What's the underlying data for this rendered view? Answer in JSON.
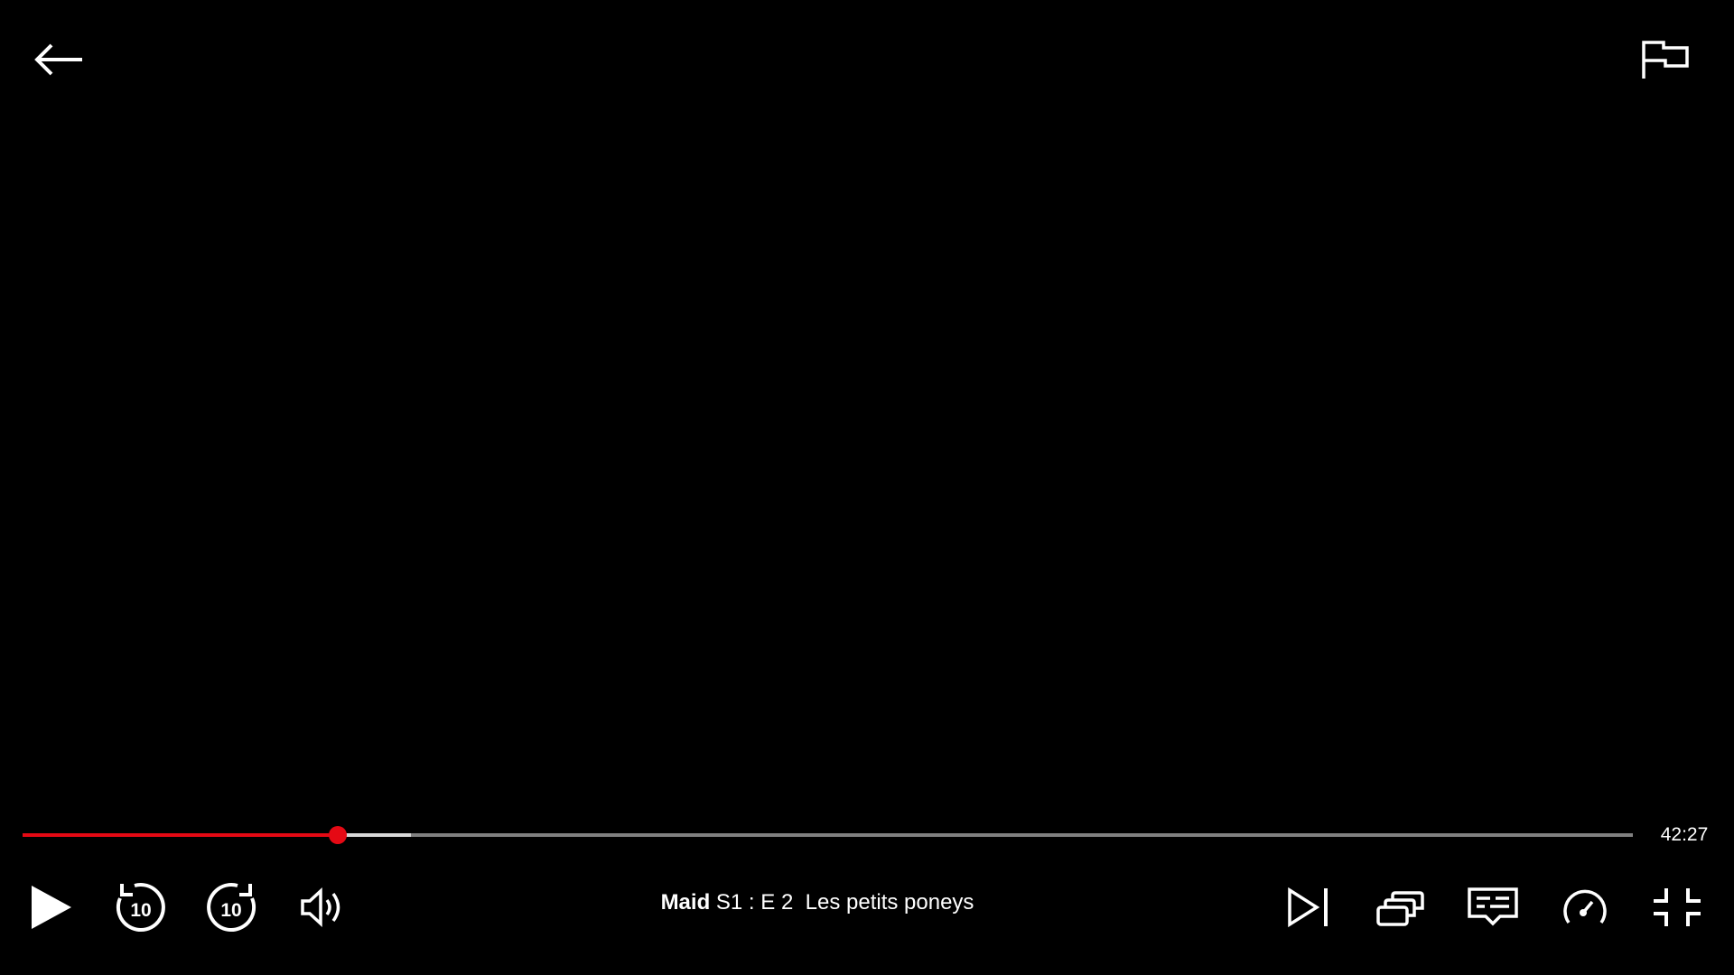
{
  "player": {
    "back": {
      "icon": "arrow-left-icon"
    },
    "report": {
      "icon": "flag-icon"
    },
    "progress": {
      "played_fraction": 0.196,
      "buffered_fraction": 0.241,
      "time_remaining": "42:27",
      "played_color": "#e50914",
      "track_color": "#808080",
      "buffered_color": "#d8d8d8"
    },
    "controls": {
      "left": [
        {
          "name": "play-button",
          "icon": "play-icon"
        },
        {
          "name": "back-10-button",
          "icon": "rewind-10-icon",
          "label": "10"
        },
        {
          "name": "forward-10-button",
          "icon": "forward-10-icon",
          "label": "10"
        },
        {
          "name": "volume-button",
          "icon": "volume-icon"
        }
      ],
      "right": [
        {
          "name": "next-episode-button",
          "icon": "next-episode-icon"
        },
        {
          "name": "episodes-button",
          "icon": "episodes-icon"
        },
        {
          "name": "subtitles-button",
          "icon": "subtitles-icon"
        },
        {
          "name": "playback-speed-button",
          "icon": "speedometer-icon"
        },
        {
          "name": "exit-fullscreen-button",
          "icon": "exit-fullscreen-icon"
        }
      ]
    },
    "title": {
      "show": "Maid",
      "episode": "S1 : E 2",
      "episode_title": "Les petits poneys"
    }
  }
}
